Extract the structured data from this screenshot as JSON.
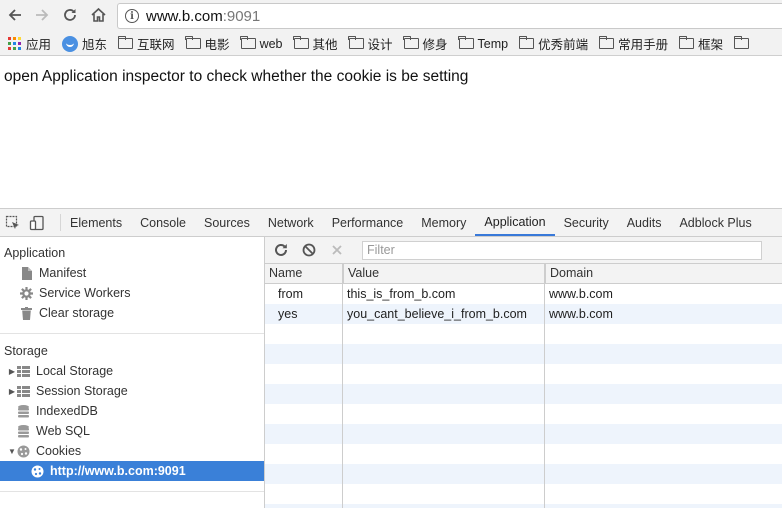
{
  "browser": {
    "url_host": "www.b.com",
    "url_port": ":9091"
  },
  "bookmarks": [
    {
      "label": "应用",
      "icon": "apps-grid-icon"
    },
    {
      "label": "旭东",
      "icon": "avatar-icon"
    },
    {
      "label": "互联网",
      "icon": "folder-icon"
    },
    {
      "label": "电影",
      "icon": "folder-icon"
    },
    {
      "label": "web",
      "icon": "folder-icon"
    },
    {
      "label": "其他",
      "icon": "folder-icon"
    },
    {
      "label": "设计",
      "icon": "folder-icon"
    },
    {
      "label": "修身",
      "icon": "folder-icon"
    },
    {
      "label": "Temp",
      "icon": "folder-icon"
    },
    {
      "label": "优秀前端",
      "icon": "folder-icon"
    },
    {
      "label": "常用手册",
      "icon": "folder-icon"
    },
    {
      "label": "框架",
      "icon": "folder-icon"
    }
  ],
  "page": {
    "text": "open Application inspector to check whether the cookie is be setting"
  },
  "devtools": {
    "tabs": [
      "Elements",
      "Console",
      "Sources",
      "Network",
      "Performance",
      "Memory",
      "Application",
      "Security",
      "Audits",
      "Adblock Plus"
    ],
    "active_tab": "Application",
    "sidebar": {
      "application_title": "Application",
      "application_items": [
        {
          "label": "Manifest",
          "icon": "file-icon"
        },
        {
          "label": "Service Workers",
          "icon": "gear-icon"
        },
        {
          "label": "Clear storage",
          "icon": "trash-icon"
        }
      ],
      "storage_title": "Storage",
      "storage_items": [
        {
          "label": "Local Storage",
          "icon": "table-icon"
        },
        {
          "label": "Session Storage",
          "icon": "table-icon"
        },
        {
          "label": "IndexedDB",
          "icon": "database-icon"
        },
        {
          "label": "Web SQL",
          "icon": "database-icon"
        },
        {
          "label": "Cookies",
          "icon": "cookie-icon"
        }
      ],
      "cookie_origin": "http://www.b.com:9091"
    },
    "filter_placeholder": "Filter",
    "table": {
      "columns": [
        "Name",
        "Value",
        "Domain"
      ],
      "rows": [
        {
          "name": "from",
          "value": "this_is_from_b.com",
          "domain": "www.b.com"
        },
        {
          "name": "yes",
          "value": "you_cant_believe_i_from_b.com",
          "domain": "www.b.com"
        }
      ]
    }
  },
  "colors": {
    "accent": "#3a80d8",
    "row_stripe": "#eef4fc"
  }
}
